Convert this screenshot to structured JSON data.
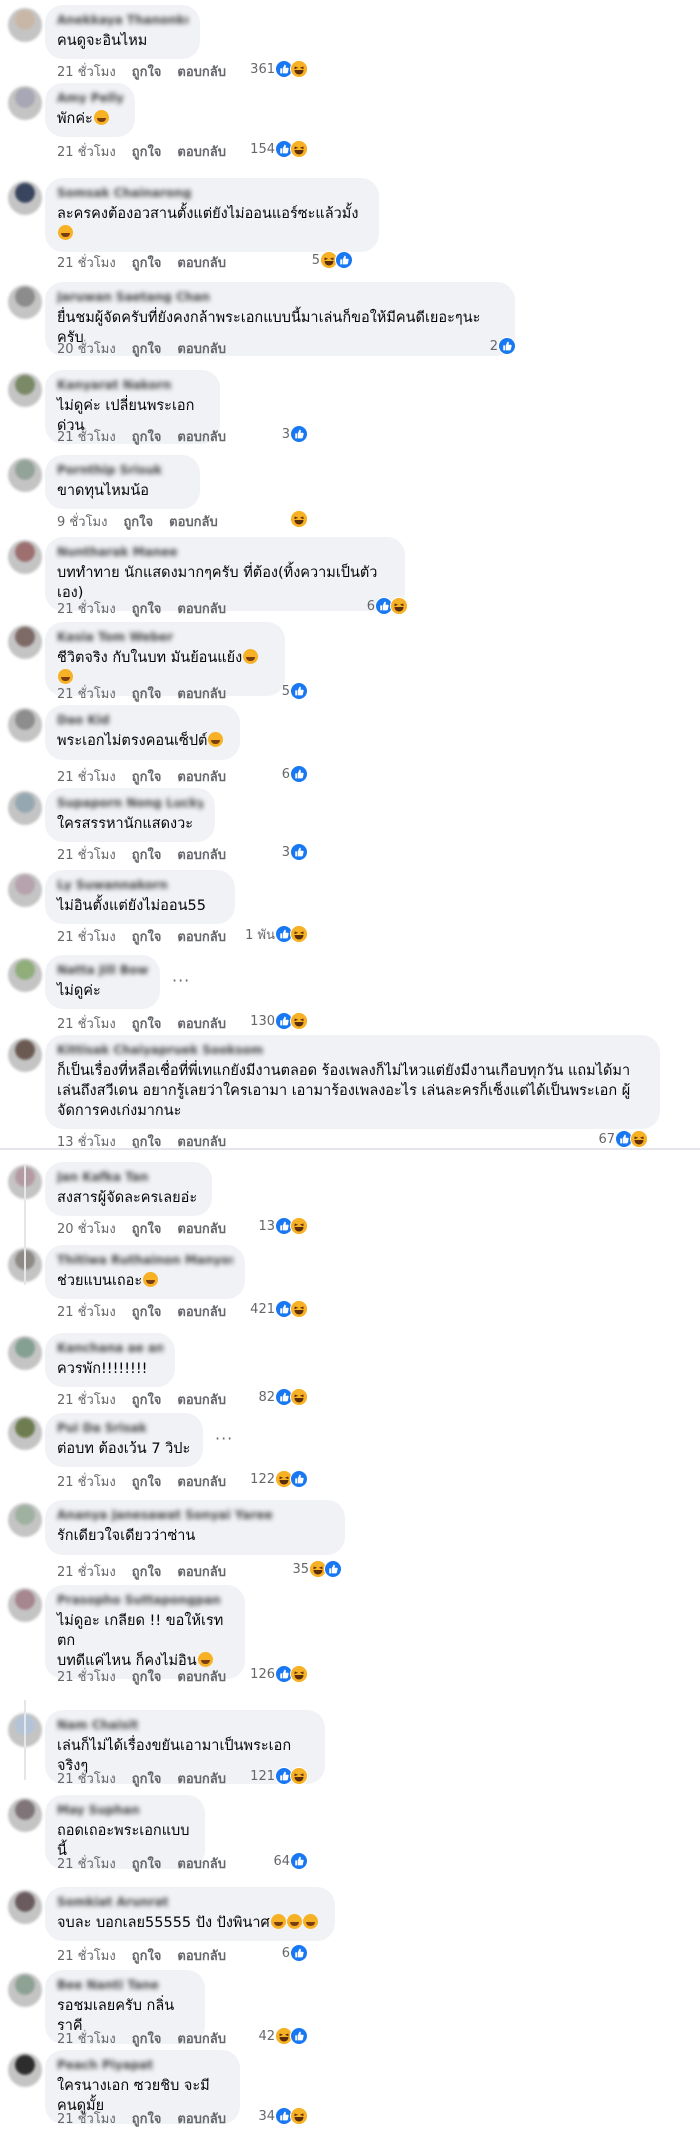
{
  "actions": {
    "like": "ถูกใจ",
    "reply": "ตอบกลับ"
  },
  "colors": {
    "bubble": "#f0f2f5",
    "like": "#1877f2",
    "haha": "#f7b125",
    "meta": "#65676b"
  },
  "comments": [
    {
      "name": "Anekkaya Thanonkul",
      "text": "คนดูจะอินไหม",
      "time": "21 ชั่วโมง",
      "count": "361",
      "reactions": [
        "like",
        "haha"
      ]
    },
    {
      "name": "Amy Pelly",
      "text": "พักค่ะ",
      "emoji": true,
      "time": "21 ชั่วโมง",
      "count": "154",
      "reactions": [
        "like",
        "haha"
      ]
    },
    {
      "name": "Somsak Chainarong",
      "text": "ละครคงต้องอวสานตั้งแต่ยังไม่ออนแอร์ซะแล้วมั้ง",
      "emoji": true,
      "time": "21 ชั่วโมง",
      "count": "5",
      "reactions": [
        "haha",
        "like"
      ]
    },
    {
      "name": "Jaruwan Saetang Chan",
      "text": "ยื่นชมผู้จัดครับที่ยังคงกล้าพระเอกแบบนี้มาเล่นก็ขอให้มีคนดีเยอะๆนะครับ",
      "time": "20 ชั่วโมง",
      "count": "2",
      "reactions": [
        "like"
      ]
    },
    {
      "name": "Kanyarat Nakorn",
      "text": "ไม่ดูค่ะ เปลี่ยนพระเอกด่วน",
      "time": "21 ชั่วโมง",
      "count": "3",
      "reactions": [
        "like"
      ]
    },
    {
      "name": "Pornthip Srisuk",
      "text": "ขาดทุนไหมน้อ",
      "time": "9 ชั่วโมง",
      "count": "",
      "reactions": [
        "haha"
      ]
    },
    {
      "name": "Nuntharak Manee",
      "text": "บททำทาย นักแสดงมากๆครับ ที่ต้อง(ทิ้งความเป็นตัวเอง)",
      "time": "21 ชั่วโมง",
      "count": "6",
      "reactions": [
        "like",
        "haha"
      ]
    },
    {
      "name": "Kasia Tom Weber",
      "text": "ชีวิตจริง กับในบท มันย้อนแย้ง",
      "emoji2": true,
      "time": "21 ชั่วโมง",
      "count": "5",
      "reactions": [
        "like"
      ]
    },
    {
      "name": "Dao Kid",
      "text": "พระเอกไม่ตรงคอนเซ็ปต์",
      "emoji": true,
      "time": "21 ชั่วโมง",
      "count": "6",
      "reactions": [
        "like"
      ]
    },
    {
      "name": "Supaporn Nong Lucky",
      "text": "ใครสรรหานักแสดงวะ",
      "time": "21 ชั่วโมง",
      "count": "3",
      "reactions": [
        "like"
      ]
    },
    {
      "name": "Ly Suwannakorn",
      "text": "ไม่อินตั้งแต่ยังไม่ออน55",
      "time": "21 ชั่วโมง",
      "count": "1 พัน",
      "reactions": [
        "like",
        "haha"
      ]
    },
    {
      "name": "Natta Jill Bowl",
      "text": "ไม่ดูค่ะ",
      "time": "21 ชั่วโมง",
      "count": "130",
      "reactions": [
        "like",
        "haha"
      ],
      "dots": true
    },
    {
      "name": "Kittisak Chaiyapruek Sooksom",
      "text": "ก็เป็นเรื่องที่หลือเชื่อที่พี่เทแกยังมีงานตลอด ร้องเพลงก็ไม่ไหวแต่ยังมีงานเกือบทุกวัน แถมได้มาเล่นถึงสวีเดน อยากรู้เลยว่าใครเอามา เอามาร้องเพลงอะไร เล่นละครก็เซ็งแต่ได้เป็นพระเอก ผู้จัดการคงเก่งมากนะ",
      "time": "13 ชั่วโมง",
      "count": "67",
      "reactions": [
        "like",
        "haha"
      ]
    },
    {
      "name": "Jan Kafka Tan",
      "text": "สงสารผู้จัดละครเลยอ่ะ",
      "time": "20 ชั่วโมง",
      "count": "13",
      "reactions": [
        "like",
        "haha"
      ]
    },
    {
      "name": "Thitiwa Ruthainon Manyoso",
      "text": "ช่วยแบนเถอะ",
      "emoji": true,
      "time": "21 ชั่วโมง",
      "count": "421",
      "reactions": [
        "like",
        "haha"
      ]
    },
    {
      "name": "Kanchana ae an",
      "text": "ควรพัก!!!!!!!!",
      "time": "21 ชั่วโมง",
      "count": "82",
      "reactions": [
        "like",
        "haha"
      ]
    },
    {
      "name": "Pui Da Srisak",
      "text": "ต่อบท ต้องเว้น 7 วิปะ",
      "time": "21 ชั่วโมง",
      "count": "122",
      "reactions": [
        "haha",
        "like"
      ],
      "dots": true
    },
    {
      "name": "Ananya Janesawat Sonyai Yaree",
      "text": "รักเดียวใจเดียวว่าซ่าน",
      "time": "21 ชั่วโมง",
      "count": "35",
      "reactions": [
        "haha",
        "like"
      ]
    },
    {
      "name": "Prasopho Suttapongpan",
      "text": "ไม่ดูอะ เกลียด !! ขอให้เรทตก\nบทดีแค่ไหน ก็คงไม่อิน",
      "emoji": true,
      "time": "21 ชั่วโมง",
      "count": "126",
      "reactions": [
        "like",
        "haha"
      ]
    },
    {
      "name": "Nam Chaisit",
      "text": "เล่นก็ไม่ได้เรื่องขยันเอามาเป็นพระเอกจริงๆ",
      "time": "21 ชั่วโมง",
      "count": "121",
      "reactions": [
        "like",
        "haha"
      ]
    },
    {
      "name": "May Suphan",
      "text": "ถอดเถอะพระเอกแบบนี้",
      "time": "21 ชั่วโมง",
      "count": "64",
      "reactions": [
        "like"
      ]
    },
    {
      "name": "Somkiat Arunrat",
      "text": "จบละ บอกเลย55555 ปัง ปังพินาศ",
      "emoji3": true,
      "time": "21 ชั่วโมง",
      "count": "6",
      "reactions": [
        "like"
      ]
    },
    {
      "name": "Bee Nanti Tane",
      "text": "รอชมเลยครับ กลิ่นราคี",
      "time": "21 ชั่วโมง",
      "count": "42",
      "reactions": [
        "haha",
        "like"
      ]
    },
    {
      "name": "Peach Piyapat",
      "text": "ใครนางเอก ซวยชิบ จะมีคนดูมั้ย",
      "time": "21 ชั่วโมง",
      "count": "34",
      "reactions": [
        "like",
        "haha"
      ]
    }
  ]
}
